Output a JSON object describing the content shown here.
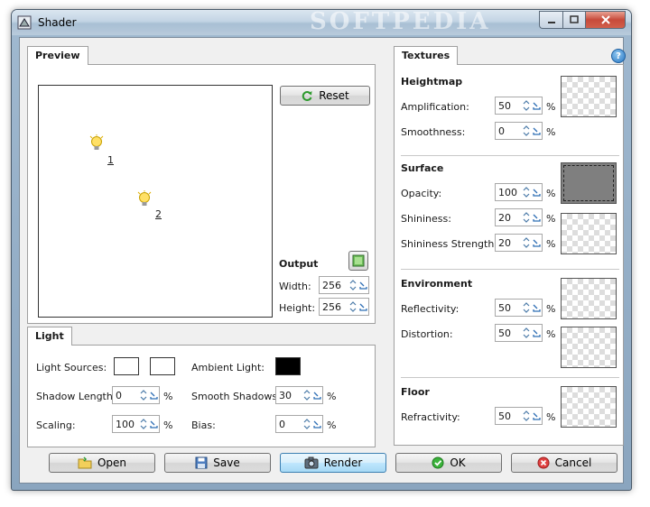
{
  "window": {
    "title": "Shader",
    "watermark": "SOFTPEDIA"
  },
  "preview": {
    "tab_label": "Preview",
    "reset_label": "Reset",
    "lights": [
      {
        "label": "1"
      },
      {
        "label": "2"
      }
    ]
  },
  "output": {
    "heading": "Output",
    "width_label": "Width:",
    "width_value": "256",
    "height_label": "Height:",
    "height_value": "256"
  },
  "light": {
    "tab_label": "Light",
    "light_sources_label": "Light Sources:",
    "ambient_light_label": "Ambient Light:",
    "shadow_length_label": "Shadow Length:",
    "shadow_length_value": "0",
    "smooth_shadows_label": "Smooth Shadows:",
    "smooth_shadows_value": "30",
    "scaling_label": "Scaling:",
    "scaling_value": "100",
    "bias_label": "Bias:",
    "bias_value": "0",
    "percent": "%",
    "ambient_color": "#000000"
  },
  "textures": {
    "tab_label": "Textures",
    "percent": "%",
    "heightmap": {
      "heading": "Heightmap",
      "amplification_label": "Amplification:",
      "amplification_value": "50",
      "smoothness_label": "Smoothness:",
      "smoothness_value": "0"
    },
    "surface": {
      "heading": "Surface",
      "opacity_label": "Opacity:",
      "opacity_value": "100",
      "shininess_label": "Shininess:",
      "shininess_value": "20",
      "shininess_strength_label": "Shininess Strength:",
      "shininess_strength_value": "20",
      "surface_color": "#7f7f7f"
    },
    "environment": {
      "heading": "Environment",
      "reflectivity_label": "Reflectivity:",
      "reflectivity_value": "50",
      "distortion_label": "Distortion:",
      "distortion_value": "50"
    },
    "floor": {
      "heading": "Floor",
      "refractivity_label": "Refractivity:",
      "refractivity_value": "50"
    }
  },
  "buttons": {
    "open": "Open",
    "save": "Save",
    "render": "Render",
    "ok": "OK",
    "cancel": "Cancel"
  }
}
